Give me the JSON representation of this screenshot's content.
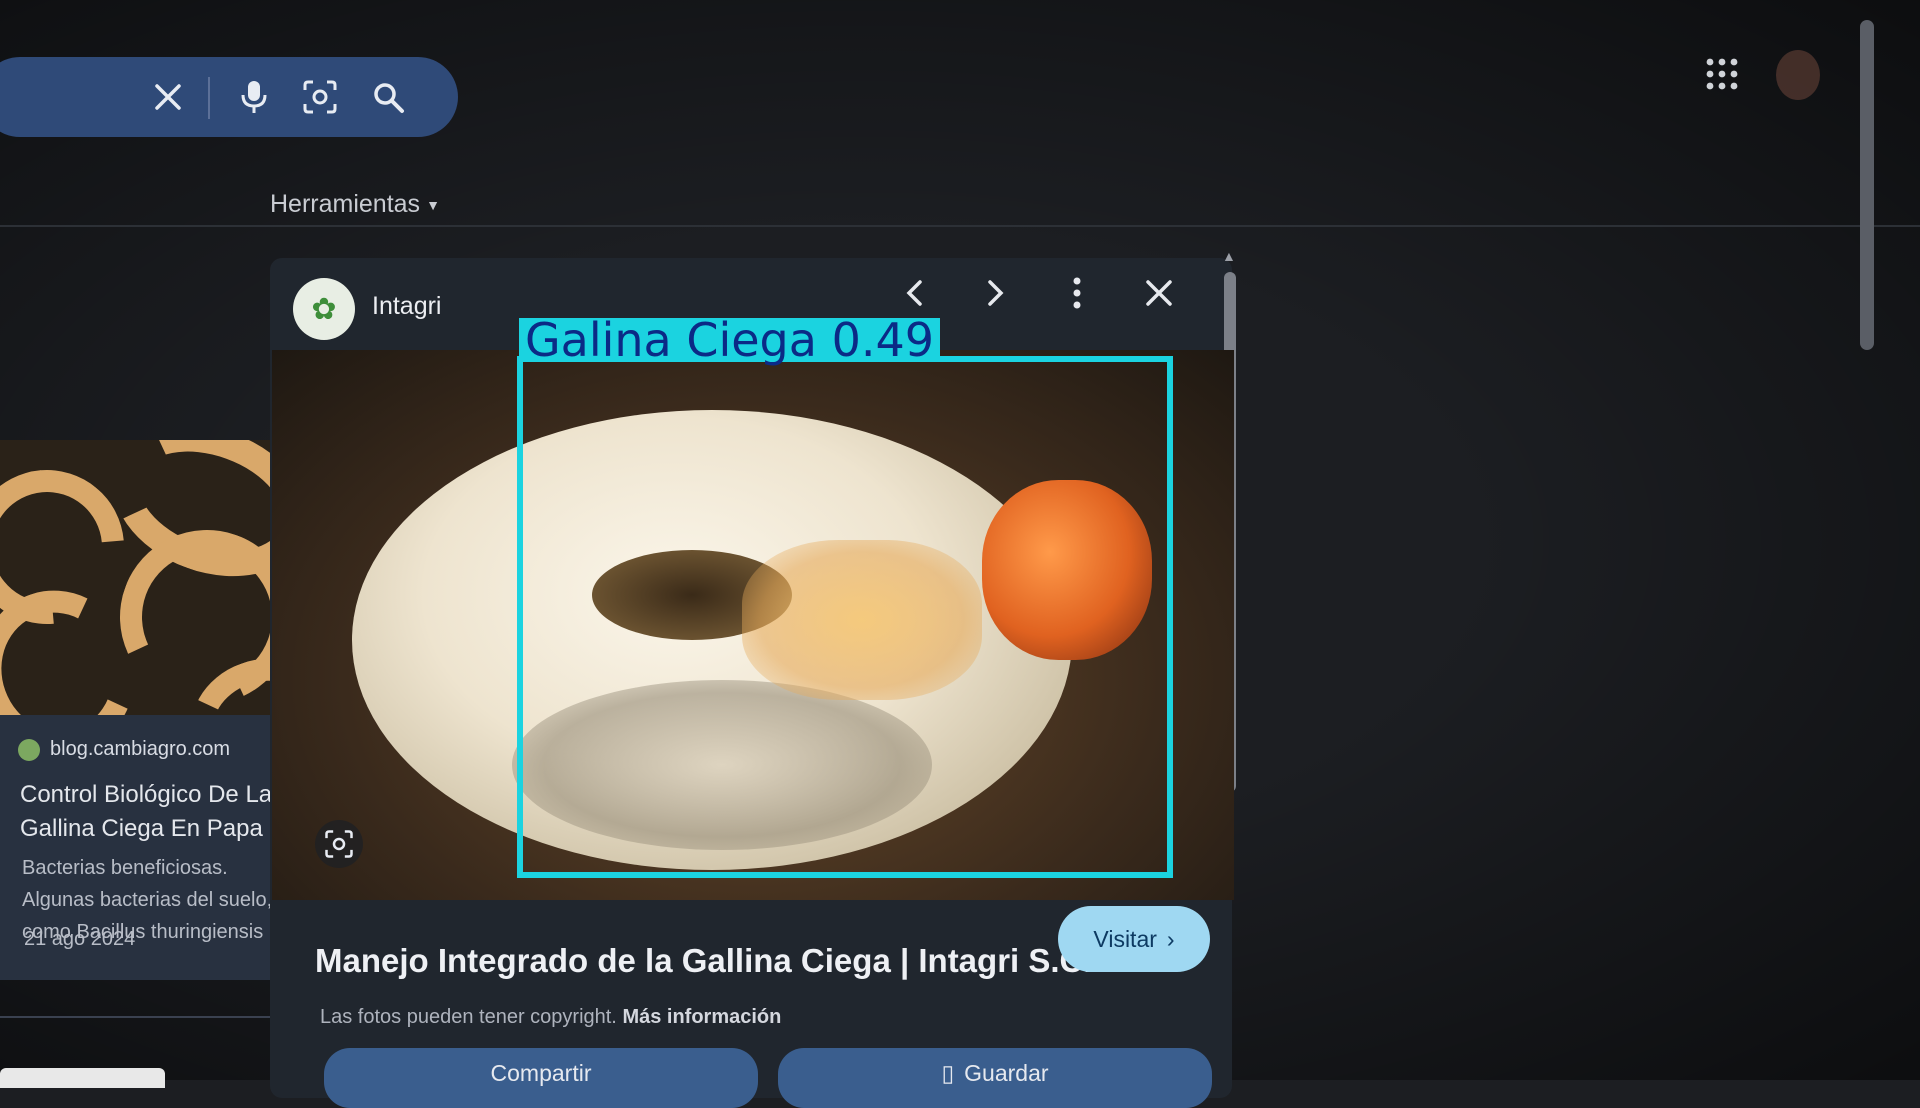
{
  "search": {
    "icons": [
      "close-icon",
      "mic-icon",
      "lens-icon",
      "search-icon"
    ]
  },
  "toolbar": {
    "tools_label": "Herramientas"
  },
  "left_result": {
    "source": "blog.cambiagro.com",
    "title": "Control Biológico De La Gallina Ciega En Papa",
    "snippet": "Bacterias beneficiosas. Algunas bacterias del suelo, como Bacillus thuringiensis",
    "date": "21 ago 2024"
  },
  "panel": {
    "source_name": "Intagri",
    "detection_label": "Galina Ciega 0.49",
    "result_title": "Manejo Integrado de la Gallina Ciega | Intagri S.C.",
    "visit_label": "Visitar",
    "copyright_text": "Las fotos pueden tener copyright.",
    "more_info": "Más información",
    "save_label": "Guardar",
    "share_label": "Compartir"
  },
  "colors": {
    "detection_box": "#1bd3e0",
    "detection_text": "#0b2a86",
    "search_bar": "#2f4a78",
    "visit_button": "#9fd8f2",
    "panel_bg": "#20262e"
  }
}
